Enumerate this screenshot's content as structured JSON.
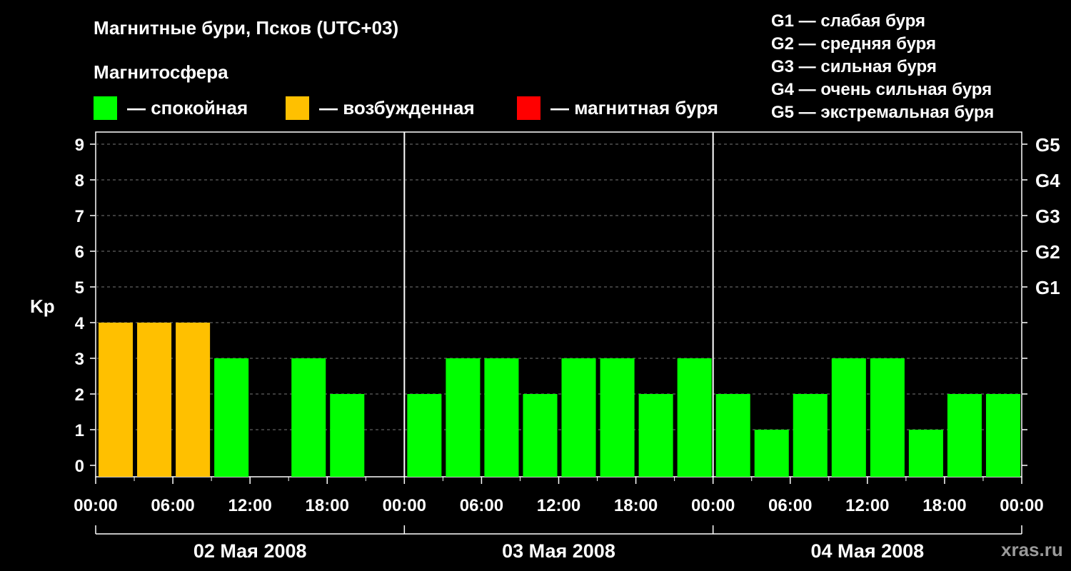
{
  "title": "Магнитные бури, Псков (UTC+03)",
  "subtitle": "Магнитосфера",
  "legend": [
    {
      "label": "— спокойная",
      "color": "#00ff00"
    },
    {
      "label": "— возбужденная",
      "color": "#ffc000"
    },
    {
      "label": "— магнитная буря",
      "color": "#ff0000"
    }
  ],
  "g_legend": [
    "G1 — слабая буря",
    "G2 — средняя буря",
    "G3 — сильная буря",
    "G4 — очень сильная буря",
    "G5 — экстремальная буря"
  ],
  "watermark": "xras.ru",
  "chart_data": {
    "type": "bar",
    "ylabel": "Kp",
    "ylim": [
      0,
      9
    ],
    "y_ticks": [
      "0",
      "1",
      "2",
      "3",
      "4",
      "5",
      "6",
      "7",
      "8",
      "9"
    ],
    "right_ticks": [
      {
        "value": 5,
        "label": "G1"
      },
      {
        "value": 6,
        "label": "G2"
      },
      {
        "value": 7,
        "label": "G3"
      },
      {
        "value": 8,
        "label": "G4"
      },
      {
        "value": 9,
        "label": "G5"
      }
    ],
    "x_tick_labels": [
      "00:00",
      "06:00",
      "12:00",
      "18:00",
      "00:00",
      "06:00",
      "12:00",
      "18:00",
      "00:00",
      "06:00",
      "12:00",
      "18:00",
      "00:00"
    ],
    "days": [
      "02 Мая 2008",
      "03 Мая 2008",
      "04 Мая 2008"
    ],
    "interval_hours": 3,
    "values": [
      4,
      4,
      4,
      3,
      0,
      3,
      2,
      0,
      2,
      3,
      3,
      2,
      3,
      3,
      2,
      3,
      2,
      1,
      2,
      3,
      3,
      1,
      2,
      2
    ],
    "colors": {
      "quiet": "#00ff00",
      "active": "#ffc000",
      "storm": "#ff0000"
    },
    "grid": true
  }
}
